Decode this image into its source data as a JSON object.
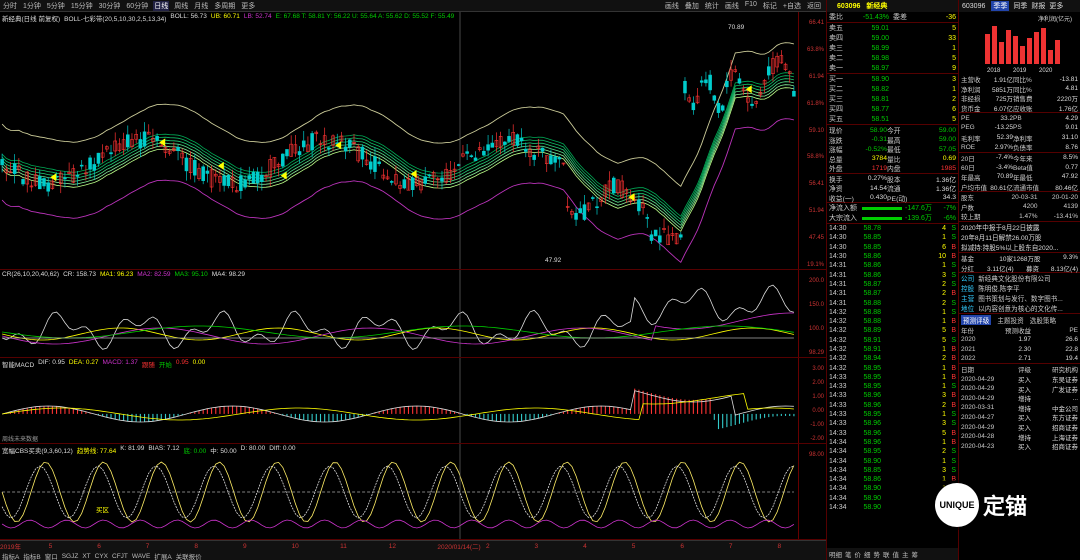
{
  "toolbar": {
    "items": [
      "分时",
      "1分钟",
      "5分钟",
      "15分钟",
      "30分钟",
      "60分钟",
      "日线",
      "周线",
      "月线",
      "多周期",
      "更多"
    ],
    "active": "日线",
    "right": [
      "画线",
      "叠加",
      "统计",
      "画线",
      "F10",
      "标记",
      "+自选",
      "返回"
    ]
  },
  "main_panel": {
    "title": "新经典(日线 前复权)",
    "indicator": "BOLL-七彩带(20,5,10,30,2,5,13,34)",
    "boll": "BOLL: 56.73",
    "ub": "UB: 60.71",
    "lb": "LB: 52.74",
    "extra": "E: 67.68 T: 58.81 Y: 56.22 U: 55.64 A: 55.62 D: 55.52 F: 55.49",
    "high_label": "70.89",
    "low_label": "47.92",
    "axis": [
      "66.41",
      "63.8%",
      "61.94",
      "61.8%",
      "59.10",
      "58.8%",
      "56.41",
      "51.94",
      "47.45",
      "19.1%"
    ]
  },
  "cr_panel": {
    "title": "CR(26,10,20,40,62)",
    "cr": "CR: 158.73",
    "ma1": "MA1: 96.23",
    "ma2": "MA2: 82.59",
    "ma3": "MA3: 95.10",
    "ma4": "MA4: 98.29",
    "axis": [
      "200.0",
      "150.0",
      "100.0",
      "98.29"
    ]
  },
  "macd_panel": {
    "title": "智能MACD",
    "dif": "DIF: 0.95",
    "dea": "DEA: 0.27",
    "macd": "MACD: 1.37",
    "side1": "跟随",
    "side2": "开始",
    "v1": "0.95",
    "v2": "0.00",
    "foot": "周线未来数据",
    "axis": [
      "3.00",
      "2.00",
      "1.00",
      "0.00",
      "-1.00",
      "-2.00"
    ]
  },
  "kdj_panel": {
    "title": "宽幅CBS买卖(9,3,60,12)",
    "trend": "趋势线: 77.64",
    "k": "K: 81.99",
    "bias": "BIAS: 7.12",
    "d1": "底: 0.00",
    "zhong": "中: 50.00",
    "d2": "D: 80.00",
    "diff": "DIff: 0.00",
    "label_buy": "买区",
    "axis": [
      "98.00"
    ]
  },
  "bottom": {
    "tabs": [
      "指标A",
      "指标B",
      "窗口",
      "SGJZ",
      "XT",
      "CYX",
      "CFJT",
      "WAVE",
      "扩展A",
      "关联报价"
    ],
    "dates": [
      "2019年",
      "5",
      "6",
      "7",
      "8",
      "9",
      "10",
      "11",
      "12",
      "2020/01/14(二)",
      "2",
      "3",
      "4",
      "5",
      "6",
      "7",
      "8"
    ],
    "period": "日线"
  },
  "quote": {
    "code": "603096",
    "name": "新经典",
    "ratio": {
      "label": "委比",
      "pct": "-51.43%",
      "label2": "委差",
      "diff": "-36"
    },
    "asks": [
      {
        "label": "卖五",
        "price": "59.01",
        "vol": "5"
      },
      {
        "label": "卖四",
        "price": "59.00",
        "vol": "33"
      },
      {
        "label": "卖三",
        "price": "58.99",
        "vol": "1"
      },
      {
        "label": "卖二",
        "price": "58.98",
        "vol": "5"
      },
      {
        "label": "卖一",
        "price": "58.97",
        "vol": "9"
      }
    ],
    "bids": [
      {
        "label": "买一",
        "price": "58.90",
        "vol": "3"
      },
      {
        "label": "买二",
        "price": "58.82",
        "vol": "1"
      },
      {
        "label": "买三",
        "price": "58.81",
        "vol": "2"
      },
      {
        "label": "买四",
        "price": "58.77",
        "vol": "6"
      },
      {
        "label": "买五",
        "price": "58.51",
        "vol": "5"
      }
    ],
    "stats": [
      [
        "现价",
        "58.90",
        "今开",
        "59.00"
      ],
      [
        "涨跌",
        "-0.31",
        "最高",
        "59.00"
      ],
      [
        "涨幅",
        "-0.52%",
        "最低",
        "57.05"
      ],
      [
        "总量",
        "3784",
        "量比",
        "0.69"
      ],
      [
        "外盘",
        "1719",
        "内盘",
        "1985"
      ]
    ],
    "stats2": [
      [
        "换手",
        "0.27%",
        "股本",
        "1.36亿"
      ],
      [
        "净资",
        "14.54",
        "流通",
        "1.36亿"
      ],
      [
        "收益(一)",
        "0.430",
        "PE(动)",
        "34.3"
      ]
    ],
    "flows": [
      {
        "label": "净流入额",
        "value": "-147.6万",
        "pct": "-7%"
      },
      {
        "label": "大宗流入",
        "value": "-139.6万",
        "pct": "-6%"
      }
    ],
    "ticks": [
      [
        "14:30",
        "58.78",
        "4",
        "S"
      ],
      [
        "14:30",
        "58.85",
        "1",
        "S"
      ],
      [
        "14:30",
        "58.85",
        "6",
        "B"
      ],
      [
        "14:30",
        "58.86",
        "10",
        "B"
      ],
      [
        "14:31",
        "58.86",
        "1",
        "S"
      ],
      [
        "14:31",
        "58.86",
        "3",
        "S"
      ],
      [
        "14:31",
        "58.87",
        "2",
        "S"
      ],
      [
        "14:31",
        "58.87",
        "2",
        "B"
      ],
      [
        "14:31",
        "58.88",
        "2",
        "S"
      ],
      [
        "14:32",
        "58.88",
        "1",
        "S"
      ],
      [
        "14:32",
        "58.88",
        "1",
        "B"
      ],
      [
        "14:32",
        "58.89",
        "5",
        "B"
      ],
      [
        "14:32",
        "58.91",
        "5",
        "S"
      ],
      [
        "14:32",
        "58.91",
        "1",
        "B"
      ],
      [
        "14:32",
        "58.94",
        "2",
        "B"
      ],
      [
        "14:32",
        "58.95",
        "1",
        "B"
      ],
      [
        "14:33",
        "58.95",
        "1",
        "B"
      ],
      [
        "14:33",
        "58.95",
        "1",
        "S"
      ],
      [
        "14:33",
        "58.96",
        "3",
        "B"
      ],
      [
        "14:33",
        "58.96",
        "2",
        "B"
      ],
      [
        "14:33",
        "58.95",
        "1",
        "S"
      ],
      [
        "14:33",
        "58.96",
        "3",
        "S"
      ],
      [
        "14:33",
        "58.96",
        "5",
        "B"
      ],
      [
        "14:34",
        "58.96",
        "1",
        "B"
      ],
      [
        "14:34",
        "58.95",
        "2",
        "S"
      ],
      [
        "14:34",
        "58.90",
        "1",
        "S"
      ],
      [
        "14:34",
        "58.85",
        "3",
        "S"
      ],
      [
        "14:34",
        "58.86",
        "1",
        "B"
      ],
      [
        "14:34",
        "58.90",
        "1",
        "B"
      ],
      [
        "14:34",
        "58.90",
        "2",
        "B"
      ],
      [
        "14:34",
        "58.90",
        "5",
        "B"
      ]
    ],
    "footer": [
      "明细",
      "笔",
      "价",
      "细",
      "势",
      "联",
      "值",
      "主",
      "筹"
    ]
  },
  "f10": {
    "code": "603096",
    "tabs": [
      "季季",
      "同季",
      "财报",
      "更多"
    ],
    "chart_label": "净利润(亿元)",
    "years": [
      "2018",
      "2019",
      "2020"
    ],
    "kv": [
      [
        "主营收",
        "1.91亿",
        "同比%",
        "-13.81"
      ],
      [
        "净利润",
        "5851万",
        "同比%",
        "4.81"
      ],
      [
        "非经损",
        "725万",
        "销售费",
        "2220万"
      ],
      [
        "货币金",
        "6.07亿",
        "应收账",
        "1.76亿"
      ]
    ],
    "kv2": [
      [
        "PE",
        "33.2",
        "PB",
        "4.29"
      ],
      [
        "PEG",
        "-13.25",
        "PS",
        "9.01"
      ],
      [
        "毛利率",
        "52.39",
        "净利率",
        "31.10"
      ],
      [
        "ROE",
        "2.97%",
        "负债率",
        "8.76"
      ]
    ],
    "kv3": [
      [
        "20日",
        "-7.4%",
        "今年来",
        "8.5%"
      ],
      [
        "60日",
        "-3.4%",
        "Beta值",
        "0.77"
      ],
      [
        "年最高",
        "70.89",
        "年最低",
        "47.92"
      ],
      [
        "户均市值",
        "80.61亿",
        "流通市值",
        "80.46亿"
      ]
    ],
    "holders": {
      "head": [
        "股东",
        "20-03-31",
        "20-01-20"
      ],
      "rows": [
        [
          "户数",
          "4200",
          "4139"
        ],
        [
          "较上期",
          "1.47%",
          "-13.41%"
        ]
      ]
    },
    "news": [
      {
        "text": "2020年中报于8月22日披露",
        "color": "#ddd"
      },
      {
        "text": "20年8月11日解禁26.00万股",
        "color": "#ddd"
      },
      {
        "text": "拟减持:持股5%以上股东自2020...",
        "color": "#ddd"
      }
    ],
    "fund": [
      "基金",
      "10家",
      "1268万股",
      "9.3%"
    ],
    "dividend": [
      "分红",
      "3.11亿(4)",
      "募资",
      "8.13亿(4)"
    ],
    "company": [
      {
        "k": "公司",
        "v": "新经典文化股份有限公司"
      },
      {
        "k": "控股",
        "v": "陈明俊,陈李平"
      },
      {
        "k": "主营",
        "v": "图书策划与发行、数字图书..."
      },
      {
        "k": "地位",
        "v": "以内容创意为核心的文化传..."
      }
    ],
    "subtabs": [
      "预测评级",
      "主题投资",
      "选股策略"
    ],
    "forecast_head": [
      "年份",
      "预测收益",
      "PE"
    ],
    "forecast": [
      [
        "2020",
        "1.97",
        "26.6"
      ],
      [
        "2021",
        "2.30",
        "22.8"
      ],
      [
        "2022",
        "2.71",
        "19.4"
      ]
    ],
    "ratings_head": [
      "日期",
      "评级",
      "研究机构"
    ],
    "ratings": [
      [
        "2020-04-29",
        "买入",
        "东吴证券"
      ],
      [
        "2020-04-29",
        "买入",
        "广发证券"
      ],
      [
        "2020-04-29",
        "增持",
        "..."
      ],
      [
        "2020-03-31",
        "增持",
        "中金公司"
      ],
      [
        "2020-04-27",
        "买入",
        "东方证券"
      ],
      [
        "2020-04-29",
        "买入",
        "招商证券"
      ],
      [
        "2020-04-28",
        "增持",
        "上海证券"
      ],
      [
        "2020-04-23",
        "买入",
        "招商证券"
      ]
    ]
  },
  "watermark": {
    "text": "定锚",
    "logo": "UNIQUE"
  },
  "colors": {
    "up": "#ff3333",
    "down": "#00cc00",
    "bg": "#000000",
    "accent": "#ffff00",
    "grid": "#550000"
  }
}
